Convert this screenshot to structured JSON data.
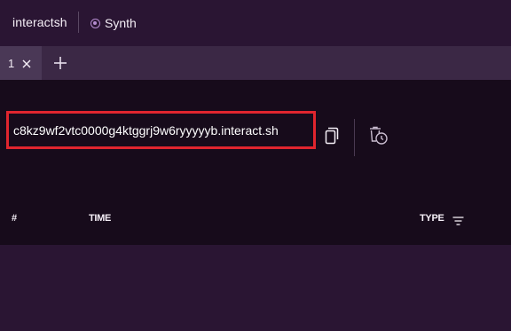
{
  "header": {
    "app_title": "interactsh",
    "mode_label": "Synth"
  },
  "tabs": [
    {
      "label": "1"
    }
  ],
  "main": {
    "interaction_url": "c8kz9wf2vtc0000g4ktggrj9w6ryyyyyb.interact.sh"
  },
  "table": {
    "columns": [
      "#",
      "TIME",
      "TYPE"
    ]
  },
  "icons": {
    "mode": "radio-icon",
    "tab_close": "close-icon",
    "add_tab": "plus-icon",
    "copy": "copy-icon",
    "clear": "trash-clock-icon",
    "filter": "filter-icon"
  },
  "colors": {
    "header_bg": "#2a1533",
    "tabbar_bg": "#3b2845",
    "active_tab_bg": "#4a3856",
    "main_bg": "#170b1b",
    "highlight_border": "#e0252e",
    "accent": "#b58cd0"
  }
}
